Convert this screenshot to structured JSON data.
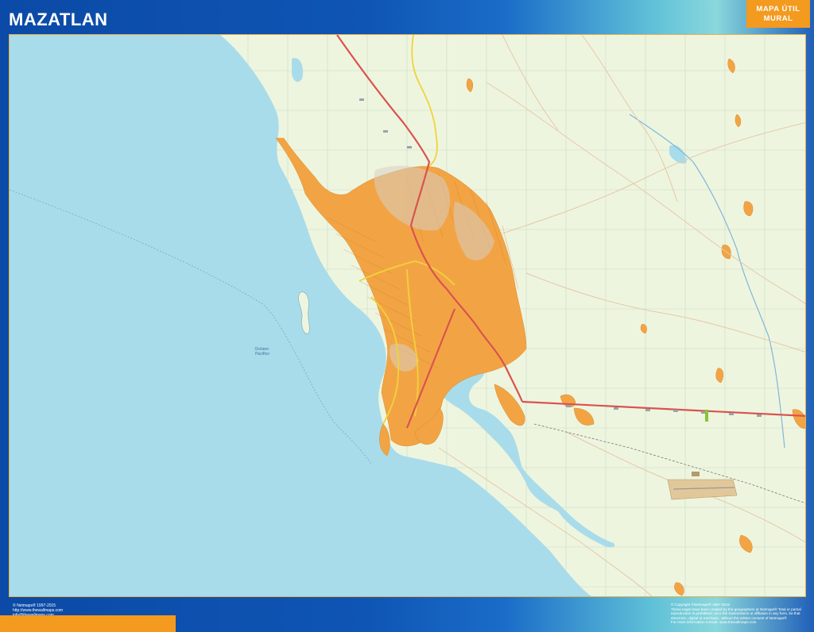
{
  "header": {
    "title": "MAZATLAN",
    "badge_line1": "MAPA ÚTIL",
    "badge_line2": "MURAL"
  },
  "map": {
    "ocean_label_line1": "Océano",
    "ocean_label_line2": "Pacífico",
    "colors": {
      "ocean": "#a9dcea",
      "land": "#eef5df",
      "urban": "#f2a444",
      "highway": "#d9534f",
      "primary_road": "#f2d23a",
      "frame_blue": "#0d4fa8",
      "accent_orange": "#f39a1f"
    }
  },
  "footer": {
    "left_line1": "© Netmaps® 1997-2015",
    "left_line2": "http://www.thewallmaps.com",
    "left_line3": "info@thewallmaps.com",
    "right_line1": "© Copyright ©Netmaps® 1997-2015",
    "right_line2": "These maps have been created by the geographers at Netmaps® Total or partial",
    "right_line3": "reproduction is prohibited; as is the transmission or diffusion in any form, be that",
    "right_line4": "electronic, digital or mechanic, without the written consent of Netmaps®",
    "right_line5": "For more information consult: www.thewallmaps.com"
  }
}
